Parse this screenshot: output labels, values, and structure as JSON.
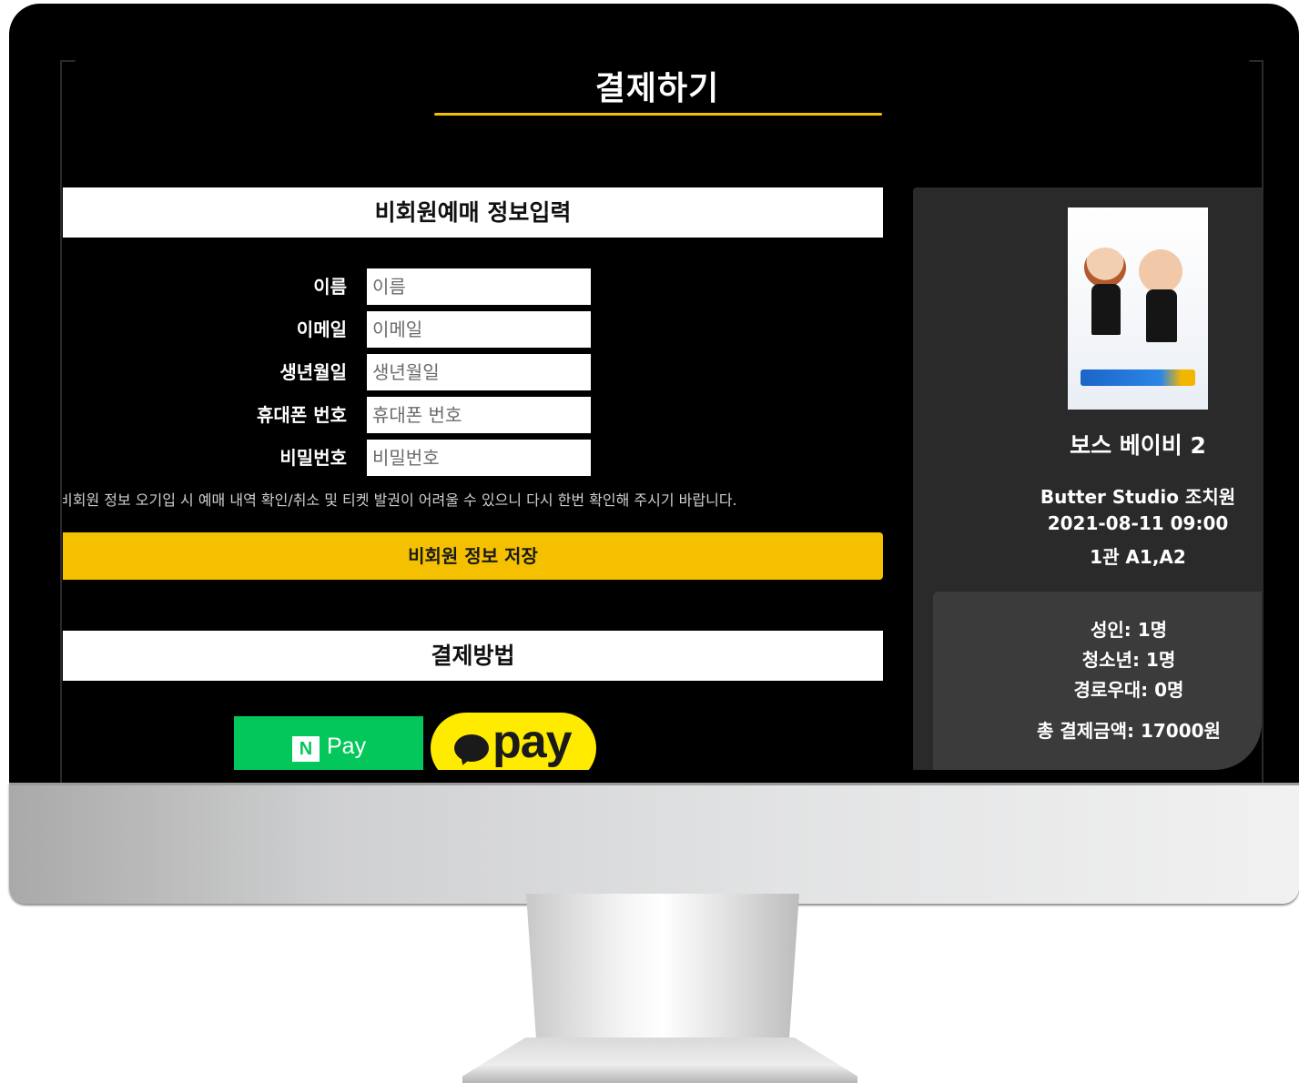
{
  "page_title": "결제하기",
  "guest_section": {
    "header": "비회원예매 정보입력",
    "fields": [
      {
        "label": "이름",
        "placeholder": "이름"
      },
      {
        "label": "이메일",
        "placeholder": "이메일"
      },
      {
        "label": "생년월일",
        "placeholder": "생년월일"
      },
      {
        "label": "휴대폰 번호",
        "placeholder": "휴대폰 번호"
      },
      {
        "label": "비밀번호",
        "placeholder": "비밀번호"
      }
    ],
    "notice": "비회원 정보 오기입 시 예매 내역 확인/취소 및 티켓 발권이 어려울 수 있으니 다시 한번 확인해 주시기 바랍니다.",
    "save_label": "비회원 정보 저장"
  },
  "payment_section": {
    "header": "결제방법",
    "naver_logo": "N",
    "naver_label": "Pay",
    "kakao_label": "pay"
  },
  "booking": {
    "movie_title": "보스 베이비 2",
    "theater": "Butter Studio 조치원",
    "datetime": "2021-08-11 09:00",
    "seats": "1관 A1,A2",
    "adult": "성인: 1명",
    "youth": "청소년: 1명",
    "senior": "경로우대: 0명",
    "total": "총 결제금액: 17000원"
  },
  "colors": {
    "accent": "#f5c000",
    "naver": "#03c75a",
    "kakao": "#ffeb00",
    "panel": "#2a2a2a"
  }
}
